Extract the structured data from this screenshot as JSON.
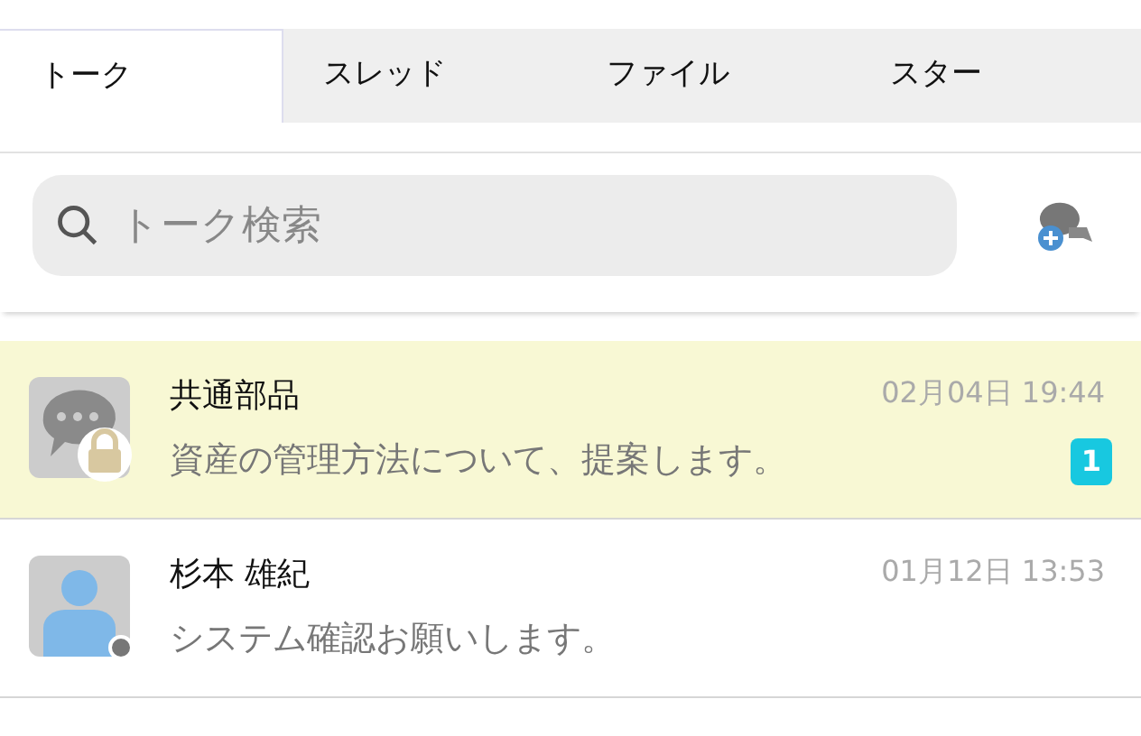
{
  "tabs": [
    {
      "label": "トーク",
      "selected": true
    },
    {
      "label": "スレッド",
      "selected": false
    },
    {
      "label": "ファイル",
      "selected": false
    },
    {
      "label": "スター",
      "selected": false
    }
  ],
  "search": {
    "placeholder": "トーク検索"
  },
  "talks": [
    {
      "kind": "group",
      "name": "共通部品",
      "time": "02月04日 19:44",
      "message": "資産の管理方法について、提案します。",
      "unread": "1",
      "selected": true
    },
    {
      "kind": "person",
      "name": "杉本 雄紀",
      "time": "01月12日 13:53",
      "message": "システム確認お願いします。",
      "color": "#777777",
      "selected": false
    }
  ]
}
